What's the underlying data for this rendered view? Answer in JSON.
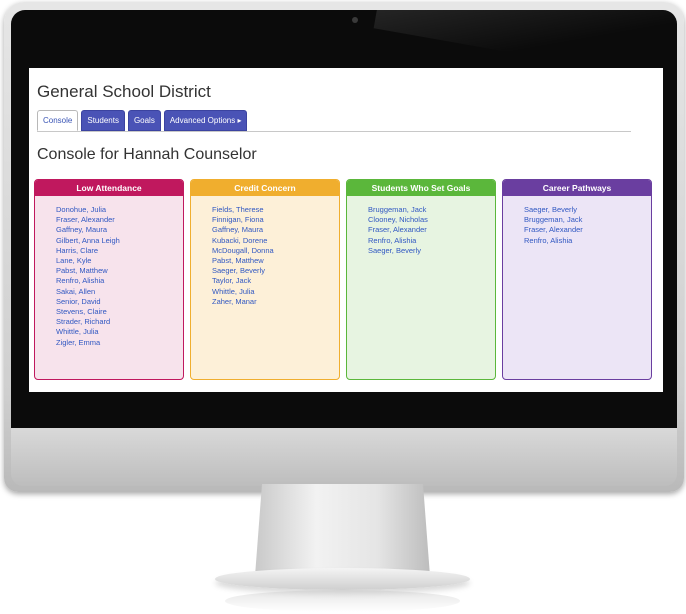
{
  "header": {
    "district_name": "General School District",
    "console_title": "Console for Hannah Counselor"
  },
  "tabs": [
    {
      "label": "Console",
      "active": true
    },
    {
      "label": "Students",
      "active": false
    },
    {
      "label": "Goals",
      "active": false
    },
    {
      "label": "Advanced Options ▸",
      "active": false
    }
  ],
  "panels": {
    "low_attendance": {
      "title": "Low Attendance",
      "color": "#c0185e",
      "students": [
        "Donohue, Julia",
        "Fraser, Alexander",
        "Gaffney, Maura",
        "Gilbert, Anna Leigh",
        "Harris, Clare",
        "Lane, Kyle",
        "Pabst, Matthew",
        "Renfro, Alishia",
        "Sakai, Allen",
        "Senior, David",
        "Stevens, Claire",
        "Strader, Richard",
        "Whittle, Julia",
        "Zigler, Emma"
      ]
    },
    "credit_concern": {
      "title": "Credit Concern",
      "color": "#f0ae2e",
      "students": [
        "Fields, Therese",
        "Finnigan, Fiona",
        "Gaffney, Maura",
        "Kubacki, Dorene",
        "McDougall, Donna",
        "Pabst, Matthew",
        "Saeger, Beverly",
        "Taylor, Jack",
        "Whittle, Julia",
        "Zaher, Manar"
      ]
    },
    "students_who_set_goals": {
      "title": "Students Who Set Goals",
      "color": "#5bb73b",
      "students": [
        "Bruggeman, Jack",
        "Clooney, Nicholas",
        "Fraser, Alexander",
        "Renfro, Alishia",
        "Saeger, Beverly"
      ]
    },
    "career_pathways": {
      "title": "Career Pathways",
      "color": "#6a3ea0",
      "students": [
        "Saeger, Beverly",
        "Bruggeman, Jack",
        "Fraser, Alexander",
        "Renfro, Alishia"
      ]
    }
  }
}
